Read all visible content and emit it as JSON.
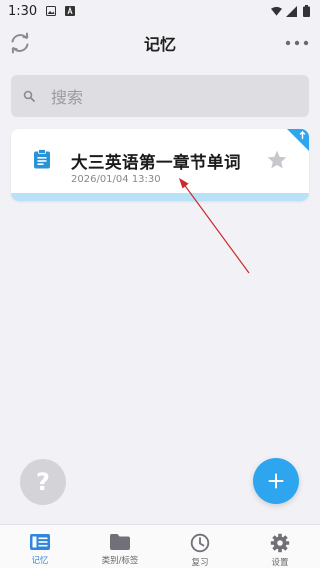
{
  "status_bar": {
    "time": "1:30"
  },
  "header": {
    "title": "记忆"
  },
  "search": {
    "placeholder": "搜索"
  },
  "memo_card": {
    "title": "大三英语第一章节单词",
    "date": "2026/01/04 13:30",
    "starred": false,
    "pinned": true
  },
  "fab": {
    "help_label": "?"
  },
  "bottom_nav": {
    "items": [
      {
        "label": "记忆",
        "icon": "memo-icon",
        "active": true
      },
      {
        "label": "类别/标签",
        "icon": "folder-icon",
        "active": false
      },
      {
        "label": "复习",
        "icon": "clock-icon",
        "active": false
      },
      {
        "label": "设置",
        "icon": "gear-icon",
        "active": false
      }
    ]
  },
  "colors": {
    "accent": "#2ea6ef",
    "nav_active": "#2e86de",
    "card_strip": "#b9e2f8",
    "annotation": "#cc2a2a",
    "background": "#f2f2f6"
  }
}
